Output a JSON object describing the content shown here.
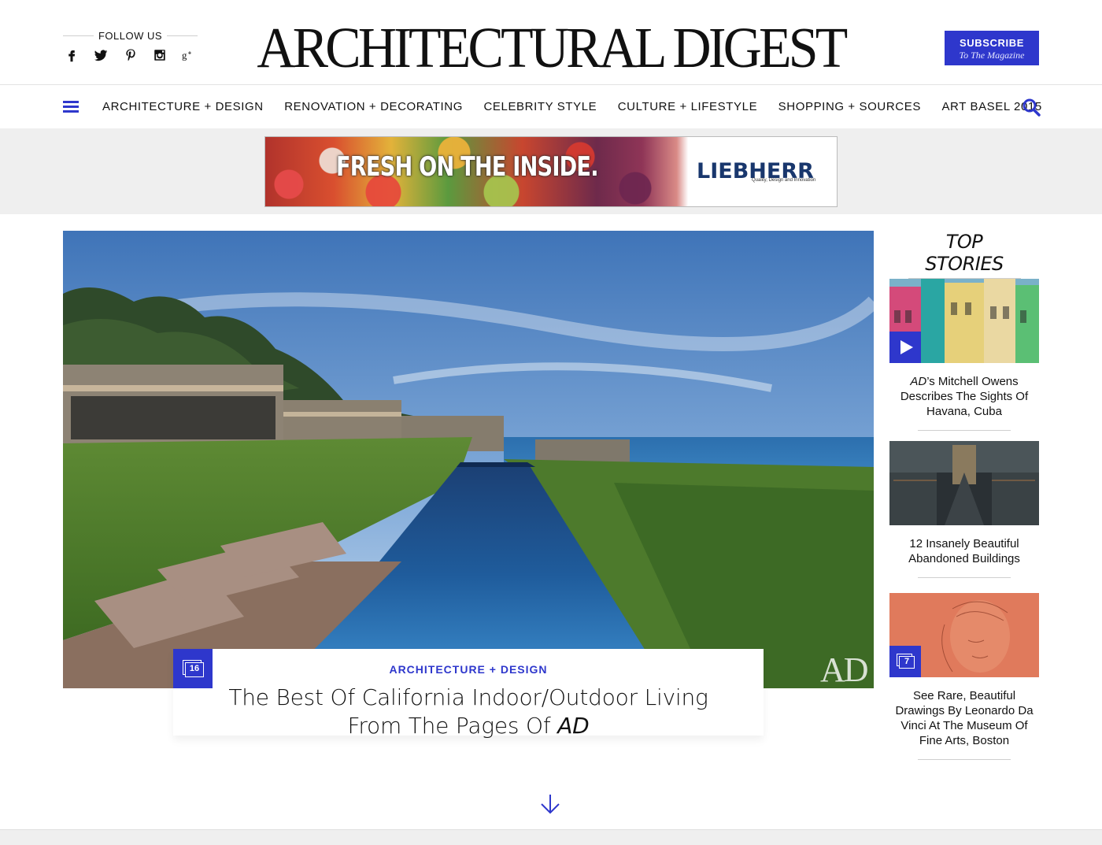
{
  "colors": {
    "accent": "#2e37cc",
    "text": "#111111",
    "band": "#efefef"
  },
  "header": {
    "follow_label": "FOLLOW US",
    "social": [
      "facebook-icon",
      "twitter-icon",
      "pinterest-icon",
      "instagram-icon",
      "google-plus-icon"
    ],
    "logo": "ARCHITECTURAL DIGEST",
    "subscribe": {
      "label": "SUBSCRIBE",
      "sublabel": "To The Magazine"
    }
  },
  "nav": {
    "items": [
      {
        "label": "ARCHITECTURE + DESIGN"
      },
      {
        "label": "RENOVATION + DECORATING"
      },
      {
        "label": "CELEBRITY STYLE"
      },
      {
        "label": "CULTURE + LIFESTYLE"
      },
      {
        "label": "SHOPPING + SOURCES"
      },
      {
        "label": "ART BASEL 2015"
      }
    ]
  },
  "ad": {
    "headline": "FRESH ON THE INSIDE.",
    "brand": "LIEBHERR",
    "tagline": "Quality, Design and Innovation"
  },
  "hero": {
    "watermark": "AD",
    "gallery_count": "16",
    "category": "ARCHITECTURE + DESIGN",
    "title_line1": "The Best Of California Indoor/Outdoor Living",
    "title_line2_prefix": "From The Pages Of ",
    "title_line2_italic": "AD"
  },
  "sidebar": {
    "title": "TOP STORIES",
    "stories": [
      {
        "title_italic": "AD",
        "title_rest": "’s Mitchell Owens Describes The Sights Of Havana, Cuba",
        "badge": "play"
      },
      {
        "title": "12 Insanely Beautiful Abandoned Buildings"
      },
      {
        "title": "See Rare, Beautiful Drawings By Leonardo Da Vinci At The Museum Of Fine Arts, Boston",
        "gallery_count": "7"
      }
    ]
  }
}
